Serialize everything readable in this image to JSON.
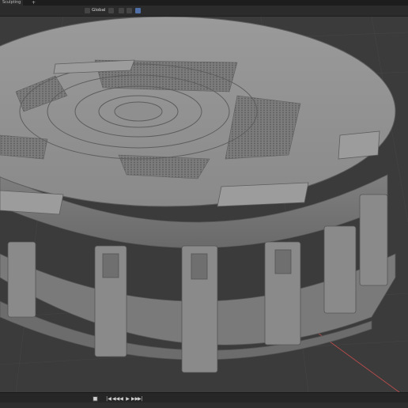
{
  "window": {
    "tab_label": "Sculpting",
    "tab_add": "+"
  },
  "toolbar": {
    "orientation_label": "Global",
    "items": [
      "transform-orientation",
      "snap",
      "proportional-editing",
      "overlays"
    ]
  },
  "viewport": {
    "background": "#3b3b3b",
    "grid_color": "#444444",
    "axis_x_color": "#b04a4a",
    "model_color": "#8e8e8e"
  },
  "timeline": {
    "controls": [
      "■",
      "|◀",
      "◀◀",
      "◀",
      "▶",
      "▶▶",
      "▶|"
    ]
  }
}
